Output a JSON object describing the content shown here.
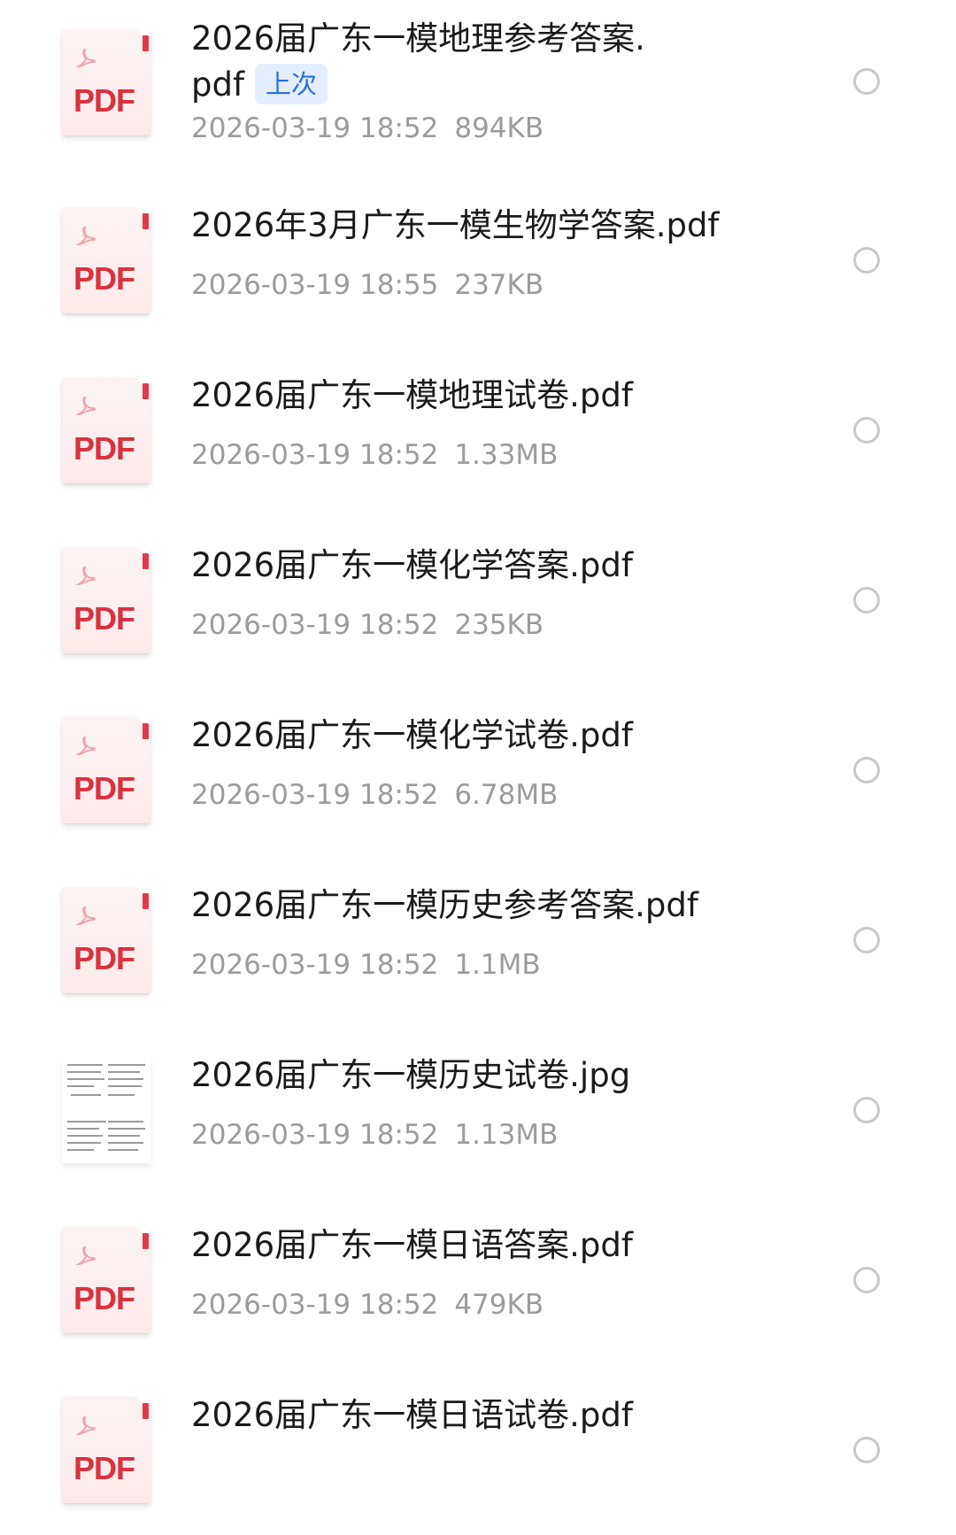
{
  "files": [
    {
      "name": "2026届广东一模地理参考答案.",
      "name_line2": "pdf",
      "tag": "上次",
      "date": "2026-03-19 18:52",
      "size": "894KB",
      "type_label": "PDF",
      "icon": "pdf-file-icon"
    },
    {
      "name": "2026年3月广东一模生物学答案.pdf",
      "date": "2026-03-19 18:55",
      "size": "237KB",
      "type_label": "PDF",
      "icon": "pdf-file-icon"
    },
    {
      "name": "2026届广东一模地理试卷.pdf",
      "date": "2026-03-19 18:52",
      "size": "1.33MB",
      "type_label": "PDF",
      "icon": "pdf-file-icon"
    },
    {
      "name": "2026届广东一模化学答案.pdf",
      "date": "2026-03-19 18:52",
      "size": "235KB",
      "type_label": "PDF",
      "icon": "pdf-file-icon"
    },
    {
      "name": "2026届广东一模化学试卷.pdf",
      "date": "2026-03-19 18:52",
      "size": "6.78MB",
      "type_label": "PDF",
      "icon": "pdf-file-icon"
    },
    {
      "name": "2026届广东一模历史参考答案.pdf",
      "date": "2026-03-19 18:52",
      "size": "1.1MB",
      "type_label": "PDF",
      "icon": "pdf-file-icon"
    },
    {
      "name": "2026届广东一模历史试卷.jpg",
      "date": "2026-03-19 18:52",
      "size": "1.13MB",
      "icon": "image-thumbnail-icon"
    },
    {
      "name": "2026届广东一模日语答案.pdf",
      "date": "2026-03-19 18:52",
      "size": "479KB",
      "type_label": "PDF",
      "icon": "pdf-file-icon"
    },
    {
      "name": "2026届广东一模日语试卷.pdf",
      "type_label": "PDF",
      "icon": "pdf-file-icon"
    }
  ],
  "colors": {
    "pdf_red": "#d9323f",
    "tag_blue": "#2a6fe0",
    "tag_bg": "#e4eefc",
    "meta_gray": "#9b9b9b"
  }
}
